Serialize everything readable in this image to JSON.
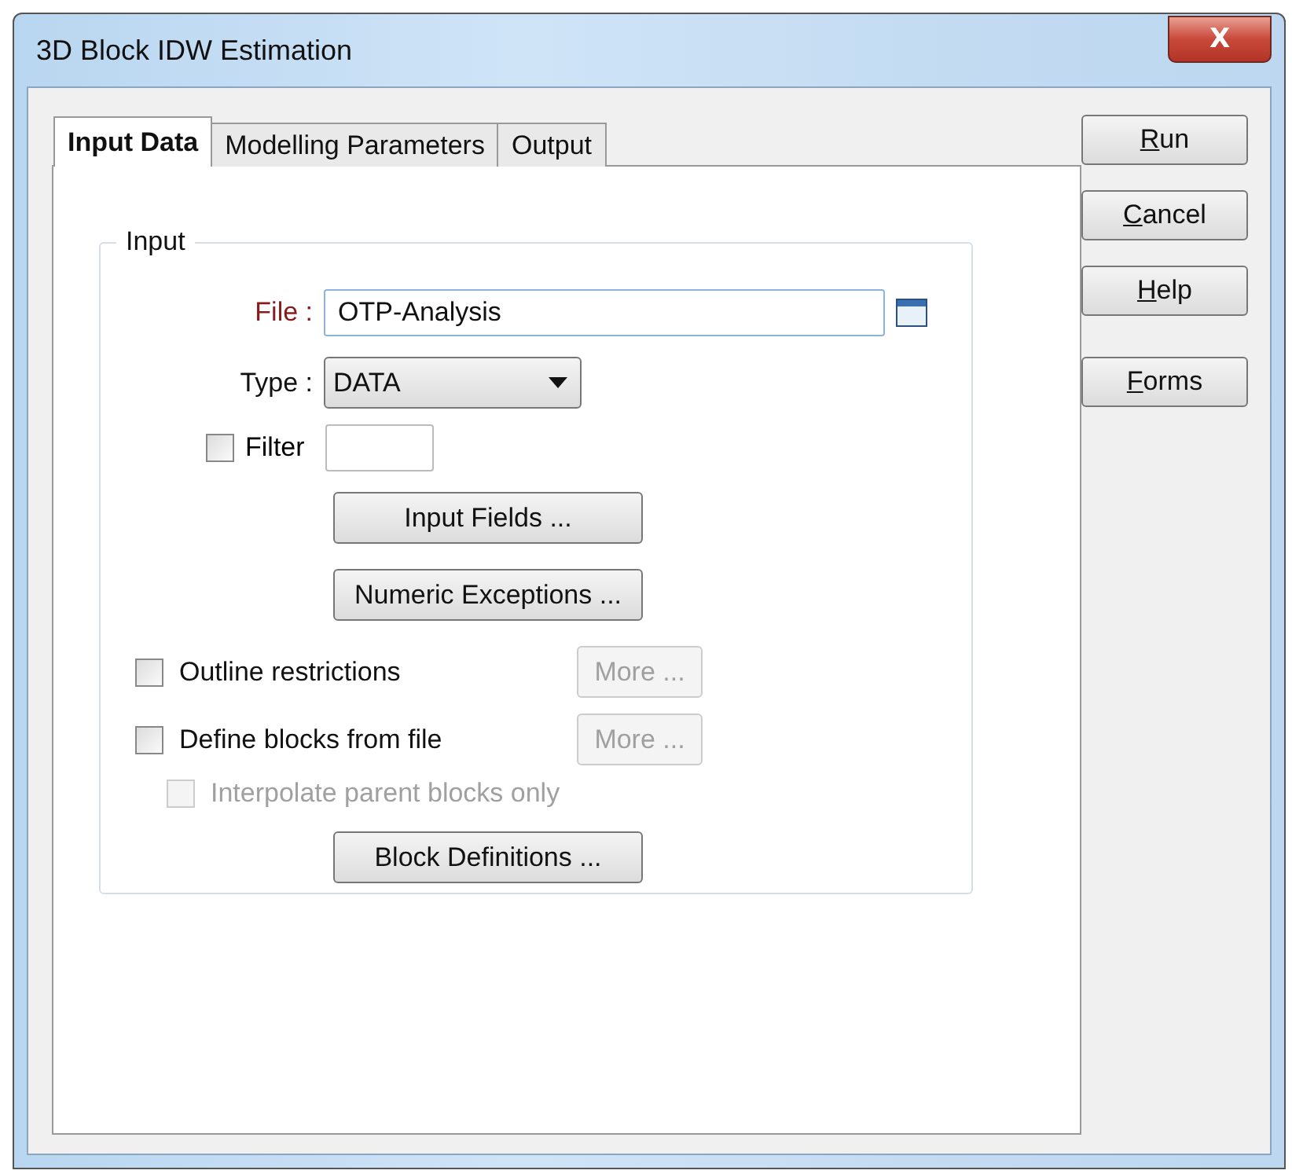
{
  "window": {
    "title": "3D Block IDW Estimation",
    "close": "X"
  },
  "tabs": [
    {
      "label": "Input Data",
      "selected": true
    },
    {
      "label": "Modelling Parameters",
      "selected": false
    },
    {
      "label": "Output",
      "selected": false
    }
  ],
  "group": {
    "title": "Input",
    "fields": [
      {
        "kind": "file",
        "label": "File :",
        "required": true,
        "value": "OTP-Analysis"
      },
      {
        "kind": "dropdown",
        "label": "Type :",
        "required": false,
        "value": "DATA"
      },
      {
        "kind": "filter",
        "label": "Filter",
        "checked": false
      }
    ],
    "items": [
      {
        "kind": "button",
        "label": "Input Fields ..."
      },
      {
        "kind": "button",
        "label": "Numeric Exceptions ..."
      },
      {
        "kind": "option",
        "label": "Outline restrictions",
        "checked": false,
        "disabled": false,
        "more": "More ...",
        "more_disabled": true
      },
      {
        "kind": "option",
        "label": "Define blocks from file",
        "checked": false,
        "disabled": false,
        "more": "More ...",
        "more_disabled": true,
        "children": [
          {
            "label": "Interpolate parent blocks only",
            "checked": false,
            "disabled": true
          }
        ]
      },
      {
        "kind": "button",
        "label": "Block Definitions ..."
      }
    ]
  },
  "side_buttons": [
    {
      "accel": "R",
      "rest": "un"
    },
    {
      "accel": "C",
      "rest": "ancel"
    },
    {
      "accel": "H",
      "rest": "elp"
    },
    {
      "accel": "F",
      "rest": "orms"
    }
  ]
}
